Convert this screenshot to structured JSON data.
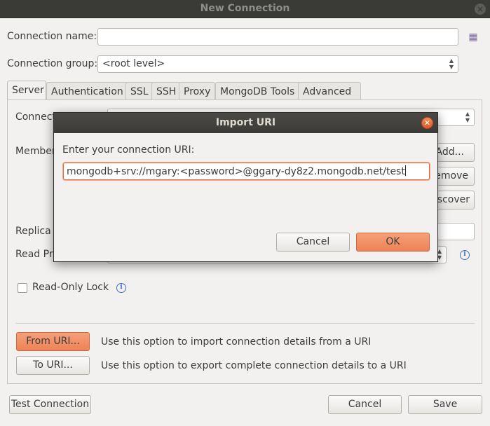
{
  "window": {
    "title": "New Connection",
    "close": "×"
  },
  "form": {
    "connection_name_label": "Connection name:",
    "connection_name_value": "",
    "connection_group_label": "Connection group:",
    "connection_group_value": "<root level>"
  },
  "tabs": [
    {
      "label": "Server",
      "active": true
    },
    {
      "label": "Authentication"
    },
    {
      "label": "SSL"
    },
    {
      "label": "SSH"
    },
    {
      "label": "Proxy"
    },
    {
      "label": "MongoDB Tools"
    },
    {
      "label": "Advanced"
    }
  ],
  "server_panel": {
    "connection_type_label": "Connect",
    "members_label": "Member",
    "add_button": "Add...",
    "remove_button": "emove",
    "discover_button": "iscover",
    "replica_set_label": "Replica S",
    "read_preference_label": "Read Pre",
    "read_only_lock_label": "Read-Only Lock",
    "from_uri_button": "From URI...",
    "from_uri_desc": "Use this option to import connection details from a URI",
    "to_uri_button": "To URI...",
    "to_uri_desc": "Use this option to export complete connection details to a URI"
  },
  "footer": {
    "test_connection": "Test Connection",
    "cancel": "Cancel",
    "save": "Save"
  },
  "dialog": {
    "title": "Import URI",
    "prompt": "Enter your connection URI:",
    "uri_value": "mongodb+srv://mgary:<password>@ggary-dy8z2.mongodb.net/test",
    "cancel": "Cancel",
    "ok": "OK"
  },
  "colors": {
    "accent": "#ee8254",
    "titlebar": "#3a3a37",
    "info": "#3b6fc4"
  }
}
